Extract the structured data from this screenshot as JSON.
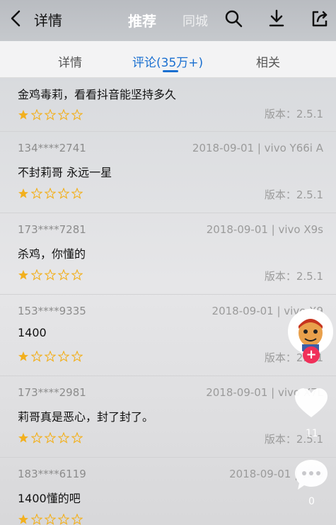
{
  "header": {
    "title": "详情",
    "tabs": [
      {
        "label": "推荐"
      },
      {
        "label": "同城"
      }
    ]
  },
  "subtabs": [
    {
      "label": "详情"
    },
    {
      "label": "评论(35万+)"
    },
    {
      "label": "相关"
    }
  ],
  "comments": [
    {
      "user": "",
      "meta": "",
      "content": "金鸡毒莉，看看抖音能坚持多久",
      "rating": 1,
      "version": "版本：2.5.1"
    },
    {
      "user": "134****2741",
      "meta": "2018-09-01 | vivo Y66i A",
      "content": "不封莉哥 永远一星",
      "rating": 1,
      "version": "版本：2.5.1"
    },
    {
      "user": "173****7281",
      "meta": "2018-09-01 | vivo X9s",
      "content": "杀鸡，你懂的",
      "rating": 1,
      "version": "版本：2.5.1"
    },
    {
      "user": "153****9335",
      "meta": "2018-09-01 | vivo X9",
      "content": "1400",
      "rating": 1,
      "version": "版本：2.5.1"
    },
    {
      "user": "173****2981",
      "meta": "2018-09-01 | vivo X7L",
      "content": "莉哥真是恶心，封了封了。",
      "rating": 1,
      "version": "版本：2.5.1"
    },
    {
      "user": "183****6119",
      "meta": "2018-09-01 | vivo",
      "content": "1400懂的吧",
      "rating": 1,
      "version": ""
    }
  ],
  "side": {
    "likes": "11",
    "comments": "0"
  },
  "colors": {
    "accent": "#1a6fd0",
    "star_filled": "#f2b01e",
    "star_empty": "#f2b01e",
    "follow_button": "#f0305a"
  }
}
